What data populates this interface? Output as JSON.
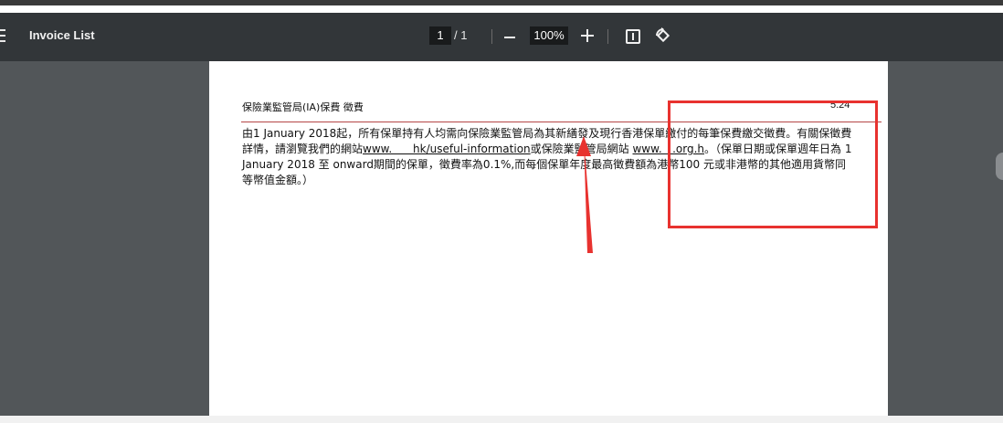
{
  "toolbar": {
    "title": "Invoice List",
    "page_current": "1",
    "page_total": "/ 1",
    "zoom_level": "100%"
  },
  "document": {
    "row_title": "保險業監管局(IA)保費 徵費",
    "row_amount": "5.24",
    "paragraph": {
      "part1": "由1 January 2018起，所有保單持有人均需向保險業監管局為其新繕發及現行香港保單繳付的每筆保費繳交徵費。有關保徵費詳情，請瀏覽我們的網站",
      "link1": "www.      hk/useful-information",
      "part2": "或保險業監管局網站 ",
      "link2": "www.   .org.h",
      "part3": "。（保單日期或保單週年日為 1 January 2018 至 onward期間的保單，徵費率為0.1%,而每個保單年度最高徵費額為港幣100 元或非港幣的其他適用貨幣同等幣值金額。）"
    }
  },
  "annotations": {
    "box_color": "#e8322f",
    "arrow_color": "#e8322f"
  },
  "icons": [
    "menu-icon",
    "zoom-out-icon",
    "zoom-in-icon",
    "fit-page-icon",
    "rotate-icon"
  ]
}
